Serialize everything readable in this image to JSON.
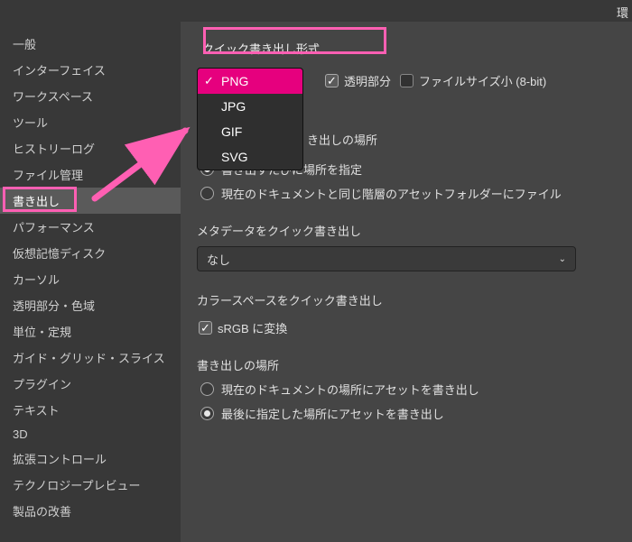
{
  "window": {
    "title_partial": "環"
  },
  "sidebar": {
    "items": [
      {
        "label": "一般"
      },
      {
        "label": "インターフェイス"
      },
      {
        "label": "ワークスペース"
      },
      {
        "label": "ツール"
      },
      {
        "label": "ヒストリーログ"
      },
      {
        "label": "ファイル管理"
      },
      {
        "label": "書き出し"
      },
      {
        "label": "パフォーマンス"
      },
      {
        "label": "仮想記憶ディスク"
      },
      {
        "label": "カーソル"
      },
      {
        "label": "透明部分・色域"
      },
      {
        "label": "単位・定規"
      },
      {
        "label": "ガイド・グリッド・スライス"
      },
      {
        "label": "プラグイン"
      },
      {
        "label": "テキスト"
      },
      {
        "label": "3D"
      },
      {
        "label": "拡張コントロール"
      },
      {
        "label": "テクノロジープレビュー"
      },
      {
        "label": "製品の改善"
      }
    ],
    "selected_index": 6
  },
  "content": {
    "quick_format": {
      "title": "クイック書き出し形式",
      "format_selected": "PNG",
      "format_options": [
        "PNG",
        "JPG",
        "GIF",
        "SVG"
      ],
      "transparent_label": "透明部分",
      "transparent_checked": true,
      "filesize_small_label": "ファイルサイズ小 (8-bit)",
      "filesize_small_checked": false
    },
    "export_location_1": {
      "title": "き出しの場所",
      "opt1": "書き出すたびに場所を指定",
      "opt2_partial": "現在のドキュメントと同じ階層のアセットフォルダーにファイル",
      "selected": 0
    },
    "metadata": {
      "title": "メタデータをクイック書き出し",
      "value": "なし"
    },
    "colorspace": {
      "title": "カラースペースをクイック書き出し",
      "option_label": "sRGB に変換",
      "option_checked": true
    },
    "export_location_2": {
      "title": "書き出しの場所",
      "opt1": "現在のドキュメントの場所にアセットを書き出し",
      "opt2": "最後に指定した場所にアセットを書き出し",
      "selected": 1
    }
  }
}
